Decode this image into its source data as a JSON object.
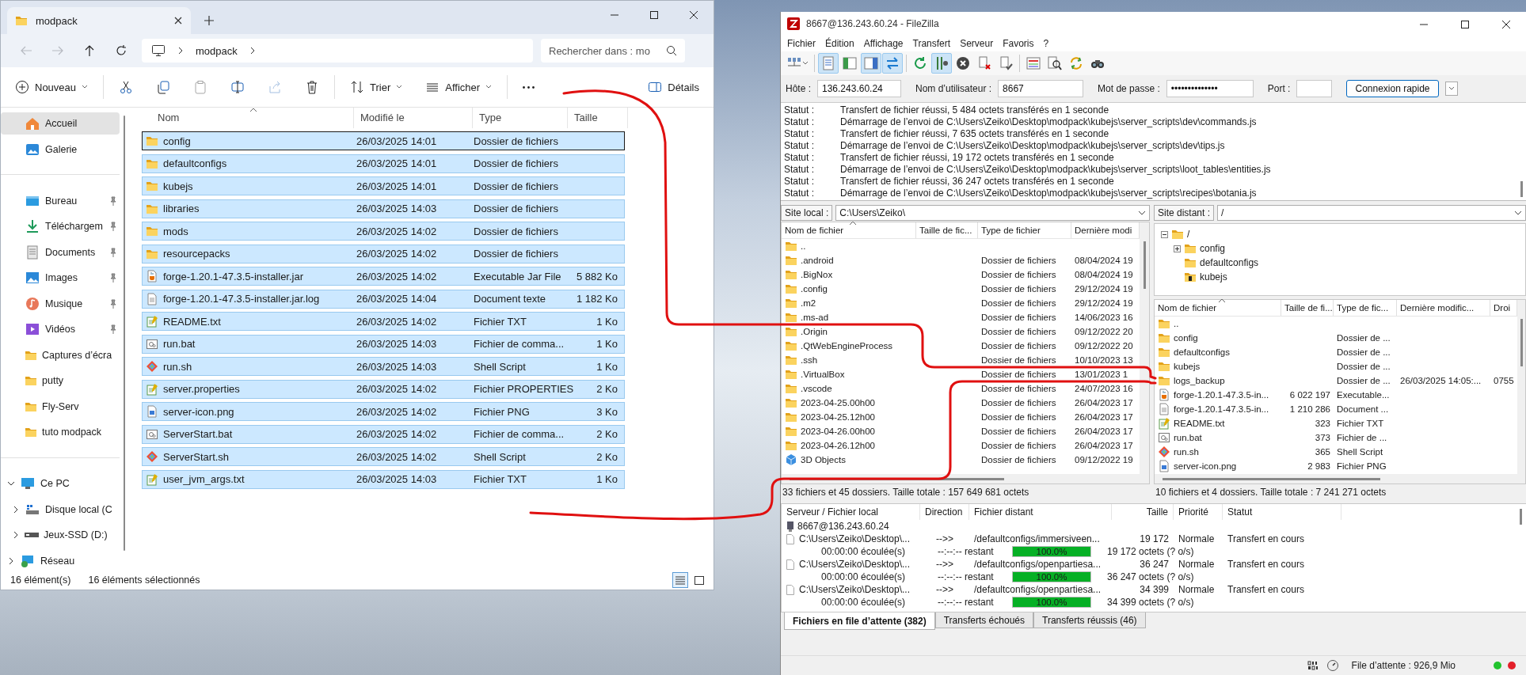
{
  "explorer": {
    "tab": {
      "title": "modpack"
    },
    "nav": [
      {
        "kind": "back",
        "disabled": true
      },
      {
        "kind": "forward",
        "disabled": true
      },
      {
        "kind": "up",
        "disabled": false
      },
      {
        "kind": "refresh",
        "disabled": false
      }
    ],
    "breadcrumb": [
      "modpack"
    ],
    "search": {
      "placeholder": "Rechercher dans : mo"
    },
    "toolbar": [
      {
        "kind": "new",
        "label": "Nouveau",
        "disabled": false
      },
      {
        "kind": "separator"
      },
      {
        "kind": "cut",
        "disabled": false
      },
      {
        "kind": "copy",
        "disabled": false
      },
      {
        "kind": "paste",
        "disabled": true
      },
      {
        "kind": "rename",
        "disabled": false
      },
      {
        "kind": "share",
        "disabled": true
      },
      {
        "kind": "delete",
        "disabled": false
      },
      {
        "kind": "separator"
      },
      {
        "kind": "sort",
        "label": "Trier",
        "disabled": false
      },
      {
        "kind": "view",
        "label": "Afficher",
        "disabled": false
      },
      {
        "kind": "separator"
      },
      {
        "kind": "more",
        "disabled": false
      },
      {
        "kind": "details",
        "label": "Détails",
        "disabled": false
      }
    ],
    "sidebar": [
      {
        "kind": "home",
        "label": "Accueil",
        "selected": true
      },
      {
        "kind": "gallery",
        "label": "Galerie",
        "selected": false
      },
      {
        "kind": "divider"
      },
      {
        "kind": "desktop",
        "label": "Bureau",
        "selected": false,
        "pinned": true
      },
      {
        "kind": "download",
        "label": "Téléchargem",
        "selected": false,
        "pinned": true
      },
      {
        "kind": "documents",
        "label": "Documents",
        "selected": false,
        "pinned": true
      },
      {
        "kind": "images",
        "label": "Images",
        "selected": false,
        "pinned": true
      },
      {
        "kind": "music",
        "label": "Musique",
        "selected": false,
        "pinned": true
      },
      {
        "kind": "videos",
        "label": "Vidéos",
        "selected": false,
        "pinned": true
      },
      {
        "kind": "folder",
        "label": "Captures d’écra",
        "selected": false,
        "pinned": false
      },
      {
        "kind": "folder",
        "label": "putty",
        "selected": false,
        "pinned": false
      },
      {
        "kind": "folder",
        "label": "Fly-Serv",
        "selected": false,
        "pinned": false
      },
      {
        "kind": "folder",
        "label": "tuto modpack",
        "selected": false,
        "pinned": false
      },
      {
        "kind": "divider"
      },
      {
        "kind": "pc",
        "label": "Ce PC",
        "selected": false,
        "expanded": true,
        "children": [
          {
            "kind": "drive",
            "label": "Disque local (C",
            "selected": false,
            "expanded": false
          },
          {
            "kind": "external-drive",
            "label": "Jeux-SSD (D:)",
            "selected": false,
            "expanded": false
          }
        ]
      },
      {
        "kind": "network",
        "label": "Réseau",
        "selected": false,
        "expanded": false
      }
    ],
    "columns": [
      {
        "label": "Nom",
        "sorted": true
      },
      {
        "label": "Modifié le",
        "sorted": false
      },
      {
        "label": "Type",
        "sorted": false
      },
      {
        "label": "Taille",
        "sorted": false
      }
    ],
    "rows": [
      {
        "kind": "folder",
        "name": "config",
        "modified": "26/03/2025 14:01",
        "type": "Dossier de fichiers",
        "selected": true,
        "focused": true
      },
      {
        "kind": "folder",
        "name": "defaultconfigs",
        "modified": "26/03/2025 14:01",
        "type": "Dossier de fichiers",
        "selected": true,
        "focused": false
      },
      {
        "kind": "folder",
        "name": "kubejs",
        "modified": "26/03/2025 14:01",
        "type": "Dossier de fichiers",
        "selected": true,
        "focused": false
      },
      {
        "kind": "folder",
        "name": "libraries",
        "modified": "26/03/2025 14:03",
        "type": "Dossier de fichiers",
        "selected": true,
        "focused": false
      },
      {
        "kind": "folder",
        "name": "mods",
        "modified": "26/03/2025 14:02",
        "type": "Dossier de fichiers",
        "selected": true,
        "focused": false
      },
      {
        "kind": "folder",
        "name": "resourcepacks",
        "modified": "26/03/2025 14:02",
        "type": "Dossier de fichiers",
        "selected": true,
        "focused": false
      },
      {
        "kind": "jar",
        "name": "forge-1.20.1-47.3.5-installer.jar",
        "modified": "26/03/2025 14:02",
        "type": "Executable Jar File",
        "size": "5 882 Ko",
        "selected": true,
        "focused": false
      },
      {
        "kind": "text",
        "name": "forge-1.20.1-47.3.5-installer.jar.log",
        "modified": "26/03/2025 14:04",
        "type": "Document texte",
        "size": "1 182 Ko",
        "selected": true,
        "focused": false
      },
      {
        "kind": "notepad",
        "name": "README.txt",
        "modified": "26/03/2025 14:02",
        "type": "Fichier TXT",
        "size": "1 Ko",
        "selected": true,
        "focused": false
      },
      {
        "kind": "batch",
        "name": "run.bat",
        "modified": "26/03/2025 14:03",
        "type": "Fichier de comma...",
        "size": "1 Ko",
        "selected": true,
        "focused": false
      },
      {
        "kind": "script",
        "name": "run.sh",
        "modified": "26/03/2025 14:03",
        "type": "Shell Script",
        "size": "1 Ko",
        "selected": true,
        "focused": false
      },
      {
        "kind": "notepad",
        "name": "server.properties",
        "modified": "26/03/2025 14:02",
        "type": "Fichier PROPERTIES",
        "size": "2 Ko",
        "selected": true,
        "focused": false
      },
      {
        "kind": "image",
        "name": "server-icon.png",
        "modified": "26/03/2025 14:02",
        "type": "Fichier PNG",
        "size": "3 Ko",
        "selected": true,
        "focused": false
      },
      {
        "kind": "batch",
        "name": "ServerStart.bat",
        "modified": "26/03/2025 14:02",
        "type": "Fichier de comma...",
        "size": "2 Ko",
        "selected": true,
        "focused": false
      },
      {
        "kind": "script",
        "name": "ServerStart.sh",
        "modified": "26/03/2025 14:02",
        "type": "Shell Script",
        "size": "2 Ko",
        "selected": true,
        "focused": false
      },
      {
        "kind": "notepad",
        "name": "user_jvm_args.txt",
        "modified": "26/03/2025 14:03",
        "type": "Fichier TXT",
        "size": "1 Ko",
        "selected": true,
        "focused": false
      }
    ],
    "status": {
      "items": "16 élément(s)",
      "selection": "16 éléments sélectionnés"
    },
    "layouts": [
      {
        "kind": "details",
        "selected": true
      },
      {
        "kind": "tiles",
        "selected": false
      }
    ]
  },
  "filezilla": {
    "title": "8667@136.243.60.24 - FileZilla",
    "menu": [
      "Fichier",
      "Édition",
      "Affichage",
      "Transfert",
      "Serveur",
      "Favoris",
      "?"
    ],
    "toolbar": [
      {
        "kind": "site-manager"
      },
      {
        "kind": "separator"
      },
      {
        "kind": "log",
        "pressed": true
      },
      {
        "kind": "local-tree",
        "pressed": false
      },
      {
        "kind": "remote-tree",
        "pressed": true
      },
      {
        "kind": "queue",
        "pressed": true
      },
      {
        "kind": "separator"
      },
      {
        "kind": "refresh"
      },
      {
        "kind": "process-queue",
        "pressed": true
      },
      {
        "kind": "cancel"
      },
      {
        "kind": "disconnect"
      },
      {
        "kind": "reconnect"
      },
      {
        "kind": "separator"
      },
      {
        "kind": "filter"
      },
      {
        "kind": "compare"
      },
      {
        "kind": "sync"
      },
      {
        "kind": "search"
      }
    ],
    "quickconnect": {
      "fields": [
        {
          "kind": "host",
          "label": "Hôte :",
          "value": "136.243.60.24"
        },
        {
          "kind": "user",
          "label": "Nom d’utilisateur :",
          "value": "8667"
        },
        {
          "kind": "password",
          "label": "Mot de passe :",
          "value": "••••••••••••••"
        },
        {
          "kind": "port",
          "label": "Port :"
        }
      ],
      "button": "Connexion rapide"
    },
    "log": [
      {
        "label": "Statut :",
        "message": "Transfert de fichier réussi, 5 484 octets transférés en 1 seconde"
      },
      {
        "label": "Statut :",
        "message": "Démarrage de l’envoi de C:\\Users\\Zeiko\\Desktop\\modpack\\kubejs\\server_scripts\\dev\\commands.js"
      },
      {
        "label": "Statut :",
        "message": "Transfert de fichier réussi, 7 635 octets transférés en 1 seconde"
      },
      {
        "label": "Statut :",
        "message": "Démarrage de l’envoi de C:\\Users\\Zeiko\\Desktop\\modpack\\kubejs\\server_scripts\\dev\\tips.js"
      },
      {
        "label": "Statut :",
        "message": "Transfert de fichier réussi, 19 172 octets transférés en 1 seconde"
      },
      {
        "label": "Statut :",
        "message": "Démarrage de l’envoi de C:\\Users\\Zeiko\\Desktop\\modpack\\kubejs\\server_scripts\\loot_tables\\entities.js"
      },
      {
        "label": "Statut :",
        "message": "Transfert de fichier réussi, 36 247 octets transférés en 1 seconde"
      },
      {
        "label": "Statut :",
        "message": "Démarrage de l’envoi de C:\\Users\\Zeiko\\Desktop\\modpack\\kubejs\\server_scripts\\recipes\\botania.js"
      }
    ],
    "local": {
      "site_label": "Site local :",
      "path": "C:\\Users\\Zeiko\\",
      "columns": [
        {
          "label": "Nom de fichier",
          "sorted": true
        },
        {
          "label": "Taille de fic...",
          "sorted": false
        },
        {
          "label": "Type de fichier",
          "sorted": false
        },
        {
          "label": "Dernière modi",
          "sorted": false
        }
      ],
      "rows": [
        {
          "kind": "folder",
          "name": ".."
        },
        {
          "kind": "folder",
          "name": ".android",
          "type": "Dossier de fichiers",
          "modified": "08/04/2024 19"
        },
        {
          "kind": "folder",
          "name": ".BigNox",
          "type": "Dossier de fichiers",
          "modified": "08/04/2024 19"
        },
        {
          "kind": "folder",
          "name": ".config",
          "type": "Dossier de fichiers",
          "modified": "29/12/2024 19"
        },
        {
          "kind": "folder",
          "name": ".m2",
          "type": "Dossier de fichiers",
          "modified": "29/12/2024 19"
        },
        {
          "kind": "folder",
          "name": ".ms-ad",
          "type": "Dossier de fichiers",
          "modified": "14/06/2023 16"
        },
        {
          "kind": "folder",
          "name": ".Origin",
          "type": "Dossier de fichiers",
          "modified": "09/12/2022 20"
        },
        {
          "kind": "folder",
          "name": ".QtWebEngineProcess",
          "type": "Dossier de fichiers",
          "modified": "09/12/2022 20"
        },
        {
          "kind": "folder",
          "name": ".ssh",
          "type": "Dossier de fichiers",
          "modified": "10/10/2023 13"
        },
        {
          "kind": "folder",
          "name": ".VirtualBox",
          "type": "Dossier de fichiers",
          "modified": "13/01/2023 1"
        },
        {
          "kind": "folder",
          "name": ".vscode",
          "type": "Dossier de fichiers",
          "modified": "24/07/2023 16"
        },
        {
          "kind": "folder",
          "name": "2023-04-25.00h00",
          "type": "Dossier de fichiers",
          "modified": "26/04/2023 17"
        },
        {
          "kind": "folder",
          "name": "2023-04-25.12h00",
          "type": "Dossier de fichiers",
          "modified": "26/04/2023 17"
        },
        {
          "kind": "folder",
          "name": "2023-04-26.00h00",
          "type": "Dossier de fichiers",
          "modified": "26/04/2023 17"
        },
        {
          "kind": "folder",
          "name": "2023-04-26.12h00",
          "type": "Dossier de fichiers",
          "modified": "26/04/2023 17"
        },
        {
          "kind": "object3d",
          "name": "3D Objects",
          "type": "Dossier de fichiers",
          "modified": "09/12/2022 19"
        }
      ],
      "summary": "33 fichiers et 45 dossiers. Taille totale : 157 649 681 octets"
    },
    "remote": {
      "site_label": "Site distant :",
      "path": "/",
      "tree": [
        {
          "kind": "folder",
          "name": "/",
          "expanded": true,
          "children": [
            {
              "kind": "folder",
              "name": "config",
              "expanded": false
            },
            {
              "kind": "folder",
              "name": "defaultconfigs"
            },
            {
              "kind": "unknown",
              "name": "kubejs"
            }
          ]
        }
      ],
      "columns": [
        {
          "label": "Nom de fichier",
          "sorted": true
        },
        {
          "label": "Taille de fi...",
          "sorted": false
        },
        {
          "label": "Type de fic...",
          "sorted": false
        },
        {
          "label": "Dernière modific...",
          "sorted": false
        },
        {
          "label": "Droi",
          "sorted": false
        }
      ],
      "rows": [
        {
          "kind": "folder",
          "name": ".."
        },
        {
          "kind": "folder",
          "name": "config",
          "type": "Dossier de ..."
        },
        {
          "kind": "folder",
          "name": "defaultconfigs",
          "type": "Dossier de ..."
        },
        {
          "kind": "folder",
          "name": "kubejs",
          "type": "Dossier de ..."
        },
        {
          "kind": "folder",
          "name": "logs_backup",
          "type": "Dossier de ...",
          "modified": "26/03/2025 14:05:...",
          "permissions": "0755"
        },
        {
          "kind": "jar",
          "name": "forge-1.20.1-47.3.5-in...",
          "size": "6 022 197",
          "type": "Executable..."
        },
        {
          "kind": "text",
          "name": "forge-1.20.1-47.3.5-in...",
          "size": "1 210 286",
          "type": "Document ..."
        },
        {
          "kind": "notepad",
          "name": "README.txt",
          "size": "323",
          "type": "Fichier TXT"
        },
        {
          "kind": "batch",
          "name": "run.bat",
          "size": "373",
          "type": "Fichier de ..."
        },
        {
          "kind": "script",
          "name": "run.sh",
          "size": "365",
          "type": "Shell Script"
        },
        {
          "kind": "image",
          "name": "server-icon.png",
          "size": "2 983",
          "type": "Fichier PNG"
        }
      ],
      "summary": "10 fichiers et 4 dossiers. Taille totale : 7 241 271 octets"
    },
    "queue": {
      "columns": [
        "Serveur / Fichier local",
        "Direction",
        "Fichier distant",
        "Taille",
        "Priorité",
        "Statut"
      ],
      "server": "8667@136.243.60.24",
      "transfers": [
        {
          "local": "C:\\Users\\Zeiko\\Desktop\\...",
          "direction": "-->>",
          "remote": "/defaultconfigs/immersiveen...",
          "size": "19 172",
          "priority": "Normale",
          "status": "Transfert en cours",
          "elapsed": "00:00:00 écoulée(s)",
          "remaining": "--:--:-- restant",
          "level": 1,
          "progress": "100.0%",
          "transferred": "19 172 octets (? o/s)"
        },
        {
          "local": "C:\\Users\\Zeiko\\Desktop\\...",
          "direction": "-->>",
          "remote": "/defaultconfigs/openpartiesa...",
          "size": "36 247",
          "priority": "Normale",
          "status": "Transfert en cours",
          "elapsed": "00:00:00 écoulée(s)",
          "remaining": "--:--:-- restant",
          "level": 1,
          "progress": "100.0%",
          "transferred": "36 247 octets (? o/s)"
        },
        {
          "local": "C:\\Users\\Zeiko\\Desktop\\...",
          "direction": "-->>",
          "remote": "/defaultconfigs/openpartiesa...",
          "size": "34 399",
          "priority": "Normale",
          "status": "Transfert en cours",
          "elapsed": "00:00:00 écoulée(s)",
          "remaining": "--:--:-- restant",
          "level": 1,
          "progress": "100.0%",
          "transferred": "34 399 octets (? o/s)"
        }
      ]
    },
    "tabs": [
      {
        "label": "Fichiers en file d’attente (382)",
        "selected": true
      },
      {
        "label": "Transferts échoués",
        "selected": false
      },
      {
        "label": "Transferts réussis (46)",
        "selected": false
      }
    ],
    "status": {
      "queue": "File d’attente : 926,9 Mio",
      "lights": [
        {
          "color": "#22c32e"
        },
        {
          "color": "#e3202a"
        }
      ]
    }
  },
  "overlay": {
    "kind": "freehand-stroke"
  }
}
